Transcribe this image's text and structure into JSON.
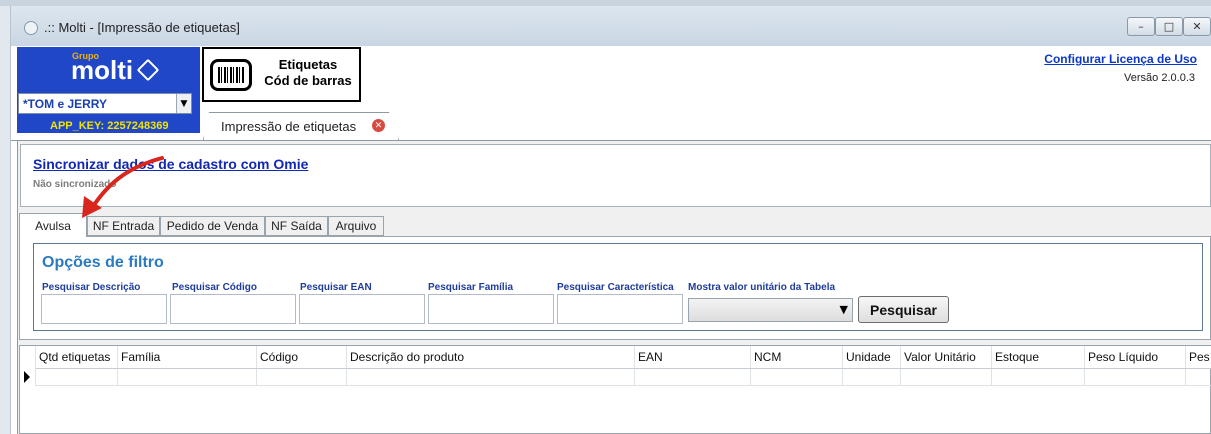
{
  "window": {
    "title": ".:: Molti - [Impressão de etiquetas]",
    "buttons": [
      "–",
      "□",
      "✕"
    ]
  },
  "brand": {
    "group": "Grupo",
    "name": "molti",
    "company": "*TOM e JERRY",
    "app_key": "APP_KEY: 2257248369",
    "colors": {
      "background": "#1f47c8",
      "group_text": "#f2b300",
      "key_text": "#f3e400"
    }
  },
  "module": {
    "title_line1": "Etiquetas",
    "title_line2": "Cód de barras"
  },
  "doc_tab": {
    "label": "Impressão de etiquetas"
  },
  "header_right": {
    "license_link": "Configurar Licença de Uso",
    "version": "Versão 2.0.0.3"
  },
  "sync": {
    "link": "Sincronizar dados de cadastro com Omie",
    "status": "Não sincronizado"
  },
  "tabs": [
    {
      "label": "Avulsa",
      "active": true
    },
    {
      "label": "NF Entrada"
    },
    {
      "label": "Pedido de Venda"
    },
    {
      "label": "NF Saída"
    },
    {
      "label": "Arquivo"
    }
  ],
  "filter": {
    "title": "Opções de filtro",
    "labels": [
      "Pesquisar Descrição",
      "Pesquisar Código",
      "Pesquisar EAN",
      "Pesquisar Família",
      "Pesquisar Característica",
      "Mostra valor unitário da Tabela"
    ],
    "select_value": "",
    "search_button": "Pesquisar"
  },
  "grid": {
    "columns": [
      "Qtd etiquetas",
      "Família",
      "Código",
      "Descrição do produto",
      "EAN",
      "NCM",
      "Unidade",
      "Valor Unitário",
      "Estoque",
      "Peso Líquido",
      "Pes"
    ],
    "rows": []
  },
  "annotation": {
    "color": "#d9261c",
    "icon": "red-arrow"
  }
}
